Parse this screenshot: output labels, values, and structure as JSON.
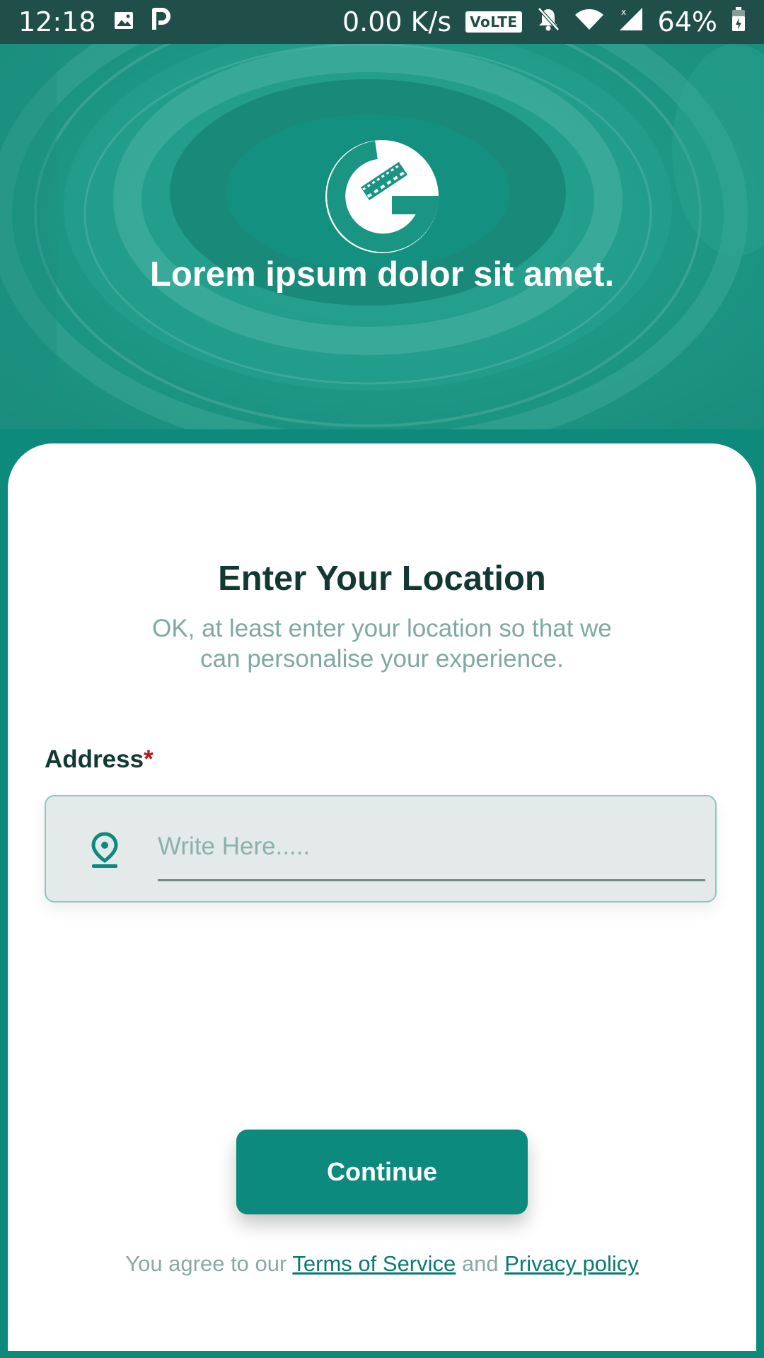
{
  "status_bar": {
    "time": "12:18",
    "net_speed": "0.00 K/s",
    "volte": "VoLTE",
    "battery": "64%",
    "icons": [
      "image-icon",
      "p-app-icon",
      "bell-off-icon",
      "wifi-icon",
      "signal-icon",
      "battery-icon"
    ]
  },
  "header": {
    "tagline": "Lorem ipsum dolor sit amet.",
    "logo_icon": "cricket-ball-logo"
  },
  "card": {
    "title": "Enter Your Location",
    "subtitle": "OK, at least enter your location so that we can personalise your experience.",
    "address_label": "Address",
    "required_mark": "*",
    "address_placeholder": "Write Here.....",
    "address_value": "",
    "location_icon": "location-pin-icon",
    "continue_label": "Continue",
    "legal": {
      "prefix": "You agree to our",
      "terms": "Terms of Service",
      "conjunction": "and",
      "privacy": "Privacy policy"
    }
  },
  "colors": {
    "primary": "#0b8a7d",
    "status_bar": "#1f4f48",
    "title_text": "#123833",
    "muted_text": "#7fa9a2",
    "required": "#b5161b"
  }
}
